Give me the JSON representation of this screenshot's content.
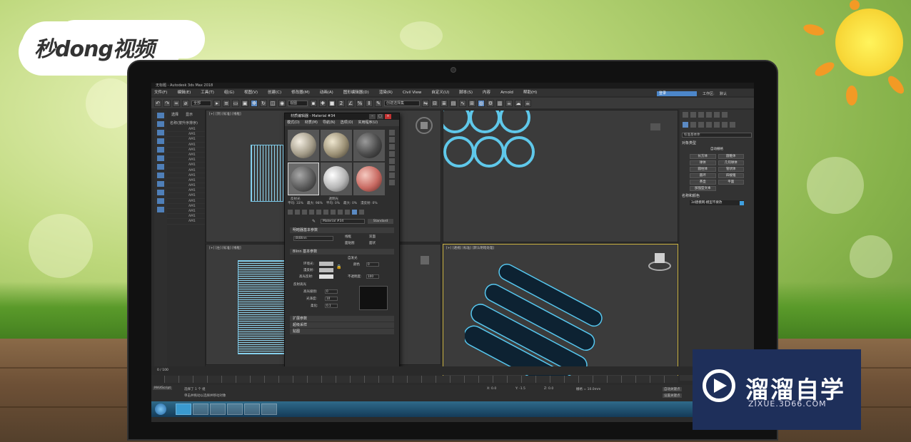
{
  "brand": {
    "logo_text": "秒dong视频"
  },
  "app": {
    "title": "无标题 - Autodesk 3ds Max 2018",
    "menus": [
      "文件(F)",
      "编辑(E)",
      "工具(T)",
      "组(G)",
      "视图(V)",
      "创建(C)",
      "修改器(M)",
      "动画(A)",
      "图形编辑器(D)",
      "渲染(R)",
      "Civil View",
      "自定义(U)",
      "脚本(S)",
      "内容",
      "Arnold",
      "帮助(H)"
    ],
    "workspace_label": "登录",
    "workspace_title": "工作区:",
    "workspace_value": "默认",
    "toolbar": {
      "selection_filter": "全部",
      "view_select": "视图",
      "selection_set": "创建选择集"
    }
  },
  "scene_explorer": {
    "tabs": [
      "选择",
      "显示"
    ],
    "header": "名称(按升序排序)",
    "row_label": "AM1",
    "row_count": 19
  },
  "viewports": {
    "top_left": "[+] [顶] [标准] [线框]",
    "bottom_left": "[+] [左] [标准] [线框]",
    "bottom_right": "[+] [透视] [标准] [默认明暗处理]"
  },
  "material_editor": {
    "title": "材质编辑器 - Material #34",
    "menus": [
      "模式(D)",
      "材质(M)",
      "导航(N)",
      "选项(O)",
      "实用程序(U)"
    ],
    "strip": {
      "labels_top": [
        "反射光",
        "透明光"
      ],
      "labels_bottom": [
        "平均: 33%",
        "最大: 98%",
        "平均: 0%",
        "最大: 0%",
        "漫反射: 0%"
      ]
    },
    "material_name": "Material #34",
    "material_type": "Standard",
    "rollouts": {
      "shader_basic": "明暗器基本参数",
      "shader": "(B)Blinn",
      "opt_wire": "线框",
      "opt_2sided": "双面",
      "opt_facemap": "面贴图",
      "opt_faceted": "面状",
      "blinn_basic": "Blinn 基本参数",
      "self_illum": "自发光",
      "color_label": "颜色",
      "ambient": "环境光:",
      "diffuse": "漫反射:",
      "specular": "高光反射:",
      "opacity": "不透明度:",
      "opacity_value": "100",
      "spec_highlights": "反射高光",
      "spec_level": "高光级别:",
      "glossiness": "光泽度:",
      "soften": "柔化:",
      "spec_level_value": "0",
      "glossiness_value": "10",
      "soften_value": "0.1",
      "self_illum_value": "0",
      "extended": "扩展参数",
      "supersampling": "超级采样",
      "maps": "贴图"
    }
  },
  "command_panel": {
    "category": "标准基本体",
    "object_type": "对象类型",
    "autogrid": "自动栅格",
    "objects": [
      "长方体",
      "圆锥体",
      "球体",
      "几何球体",
      "圆柱体",
      "管状体",
      "圆环",
      "四棱锥",
      "茶壶",
      "平面",
      "加强型文本"
    ],
    "name_color": "名称和颜色",
    "object_name": "3d建模网-模型不要改",
    "swatch_color": "#3fa0e0"
  },
  "timeline": {
    "frame": "0 / 100"
  },
  "status": {
    "selected": "选择了 1 个 组",
    "hint": "单击并拖动以选择并移动对象",
    "script": "MAXScript",
    "x": "X: 0.0",
    "y": "Y: -1.5",
    "z": "Z: 0.0",
    "grid": "栅格 = 10.0mm",
    "autokey": "自动关键点",
    "setkey": "设置关键点"
  },
  "watermark": {
    "title": "溜溜自学",
    "url": "ZIXUE.3D66.COM"
  }
}
